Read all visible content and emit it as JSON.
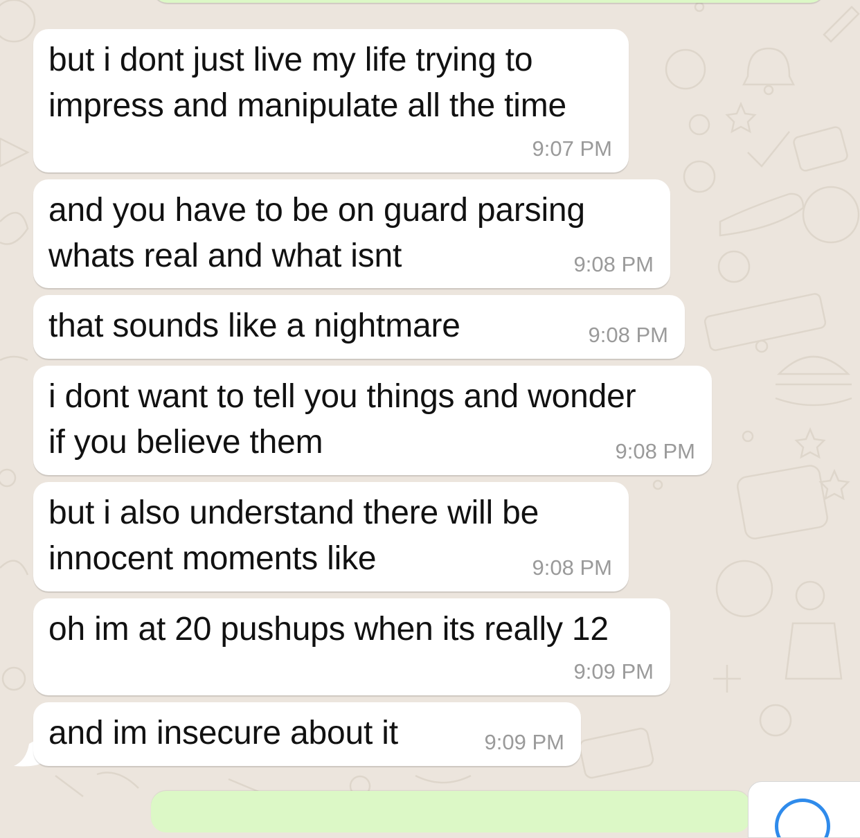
{
  "chat": {
    "messages": [
      {
        "text": "but i dont just live my life trying to\nimpress and manipulate all the time",
        "time": "9:07 PM"
      },
      {
        "text": "and you have to be on guard parsing\nwhats real and what isnt",
        "time": "9:08 PM"
      },
      {
        "text": "that sounds like a nightmare",
        "time": "9:08 PM"
      },
      {
        "text": "i dont want to tell you things and wonder\nif you believe them",
        "time": "9:08 PM"
      },
      {
        "text": "but i also understand there will be\ninnocent moments like",
        "time": "9:08 PM"
      },
      {
        "text": "oh im at 20 pushups when its really 12",
        "time": "9:09 PM"
      },
      {
        "text": "and im insecure about it",
        "time": "9:09 PM"
      }
    ]
  },
  "colors": {
    "background": "#ECE5DD",
    "incoming_bubble": "#FFFFFF",
    "outgoing_bubble": "#DCF8C6",
    "timestamp": "#9A9A9A",
    "accent": "#2F8BEB"
  }
}
